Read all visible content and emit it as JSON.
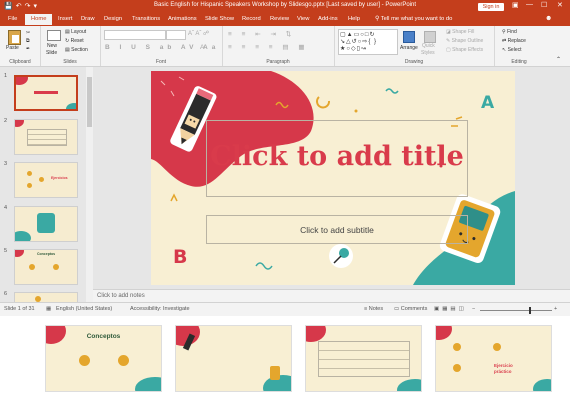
{
  "titlebar": {
    "title": "Basic English for Hispanic Speakers Workshop by Slidesgo.pptx [Last saved by user]  -  PowerPoint",
    "sign_in": "Sign in"
  },
  "tabs": [
    "File",
    "Home",
    "Insert",
    "Draw",
    "Design",
    "Transitions",
    "Animations",
    "Slide Show",
    "Record",
    "Review",
    "View",
    "Add-ins",
    "Help"
  ],
  "active_tab": "Home",
  "tell_me": "Tell me what you want to do",
  "ribbon": {
    "clipboard": {
      "paste": "Paste",
      "label": "Clipboard"
    },
    "slides": {
      "new_slide_1": "New",
      "new_slide_2": "Slide",
      "layout": "Layout",
      "reset": "Reset",
      "section": "Section",
      "label": "Slides"
    },
    "font": {
      "label": "Font"
    },
    "paragraph": {
      "label": "Paragraph"
    },
    "drawing": {
      "arrange": "Arrange",
      "quick_styles_1": "Quick",
      "quick_styles_2": "Styles",
      "shape_fill": "Shape Fill",
      "shape_outline": "Shape Outline",
      "shape_effects": "Shape Effects",
      "label": "Drawing"
    },
    "editing": {
      "find": "Find",
      "replace": "Replace",
      "select": "Select",
      "label": "Editing"
    }
  },
  "thumbnails": [
    "1",
    "2",
    "3",
    "4",
    "5",
    "6"
  ],
  "thumb_texts": {
    "t3": "Ejercicios",
    "t5": "Conceptos"
  },
  "slide": {
    "title_placeholder": "Click to add title",
    "subtitle_placeholder": "Click to add subtitle",
    "deco_b": "B",
    "deco_a": "A"
  },
  "notes_placeholder": "Click to add notes",
  "status": {
    "slide_count": "Slide 1 of 31",
    "language": "English (United States)",
    "accessibility": "Accessibility: Investigate",
    "notes": "Notes",
    "comments": "Comments"
  },
  "bottom_thumbs": {
    "t1_title": "Conceptos",
    "t4_title_1": "Ejercicio",
    "t4_title_2": "práctico"
  },
  "colors": {
    "accent": "#c43e1c",
    "slide_bg": "#f8efd3",
    "title_red": "#d93b4b",
    "teal": "#3aa9a3",
    "red_shape": "#d6384a"
  }
}
